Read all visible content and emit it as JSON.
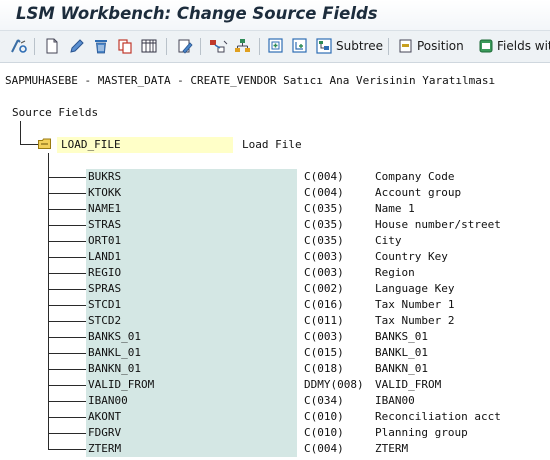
{
  "window": {
    "title": "LSM Workbench: Change Source Fields"
  },
  "toolbar": {
    "icons": [
      "toggle-display-change-icon",
      "create-icon",
      "change-icon",
      "delete-icon",
      "copy-icon",
      "table-maintenance-icon",
      "edit-icon",
      "move-icon",
      "hierarchy-icon",
      "insert-icon",
      "insert-subordinate-icon"
    ],
    "subtree_label": "Subtree",
    "position_label": "Position",
    "fields_label": "Fields with"
  },
  "info_line": "SAPMUHASEBE - MASTER_DATA - CREATE_VENDOR Satıcı Ana Verisinin Yaratılması",
  "tree": {
    "root_label": "Source Fields",
    "structure": {
      "name": "LOAD_FILE",
      "description": "Load File"
    },
    "fields": [
      {
        "name": "BUKRS",
        "type": "C(004)",
        "description": "Company Code"
      },
      {
        "name": "KTOKK",
        "type": "C(004)",
        "description": "Account group"
      },
      {
        "name": "NAME1",
        "type": "C(035)",
        "description": "Name 1"
      },
      {
        "name": "STRAS",
        "type": "C(035)",
        "description": "House number/street"
      },
      {
        "name": "ORT01",
        "type": "C(035)",
        "description": "City"
      },
      {
        "name": "LAND1",
        "type": "C(003)",
        "description": "Country Key"
      },
      {
        "name": "REGIO",
        "type": "C(003)",
        "description": "Region"
      },
      {
        "name": "SPRAS",
        "type": "C(002)",
        "description": "Language Key"
      },
      {
        "name": "STCD1",
        "type": "C(016)",
        "description": "Tax Number 1"
      },
      {
        "name": "STCD2",
        "type": "C(011)",
        "description": "Tax Number 2"
      },
      {
        "name": "BANKS_01",
        "type": "C(003)",
        "description": "BANKS_01"
      },
      {
        "name": "BANKL_01",
        "type": "C(015)",
        "description": "BANKL_01"
      },
      {
        "name": "BANKN_01",
        "type": "C(018)",
        "description": "BANKN_01"
      },
      {
        "name": "VALID_FROM",
        "type": "DDMY(008)",
        "description": "VALID_FROM"
      },
      {
        "name": "IBAN00",
        "type": "C(034)",
        "description": "IBAN00"
      },
      {
        "name": "AKONT",
        "type": "C(010)",
        "description": "Reconciliation acct"
      },
      {
        "name": "FDGRV",
        "type": "C(010)",
        "description": "Planning group"
      },
      {
        "name": "ZTERM",
        "type": "C(004)",
        "description": "ZTERM"
      }
    ]
  }
}
